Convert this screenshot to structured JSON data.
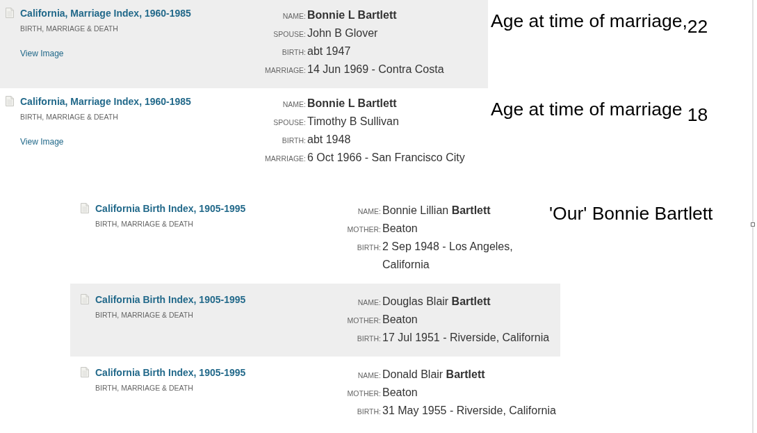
{
  "sections": [
    {
      "kind": "marriage",
      "records": [
        {
          "highlighted": true,
          "title": "California, Marriage Index, 1960-1985",
          "category": "BIRTH, MARRIAGE & DEATH",
          "link": "View Image",
          "fields": [
            {
              "kind": "heading",
              "label": "NAME:",
              "value": "Bonnie L Bartlett"
            },
            {
              "kind": "detail",
              "label": "SPOUSE:",
              "value": "John B Glover"
            },
            {
              "kind": "detail",
              "label": "BIRTH:",
              "value": "abt 1947"
            },
            {
              "kind": "detail",
              "label": "MARRIAGE:",
              "value": "14 Jun 1969 - Contra Costa"
            }
          ],
          "annotation": "Age at time of marriage,$_{22}$"
        },
        {
          "highlighted": false,
          "title": "California, Marriage Index, 1960-1985",
          "category": "BIRTH, MARRIAGE & DEATH",
          "link": "View Image",
          "fields": [
            {
              "kind": "heading",
              "label": "NAME:",
              "value": "Bonnie L Bartlett"
            },
            {
              "kind": "detail",
              "label": "SPOUSE:",
              "value": "Timothy B Sullivan"
            },
            {
              "kind": "detail",
              "label": "BIRTH:",
              "value": "abt 1948"
            },
            {
              "kind": "detail",
              "label": "MARRIAGE:",
              "value": "6 Oct 1966 - San Francisco City"
            }
          ],
          "annotation": "Age at time of marriage $_{18}$"
        }
      ]
    },
    {
      "kind": "birth",
      "records": [
        {
          "highlighted": false,
          "title": "California Birth Index, 1905-1995",
          "category": "BIRTH, MARRIAGE & DEATH",
          "fields": [
            {
              "kind": "detail",
              "label": "NAME:",
              "value": "Bonnie Lillian **Bartlett**"
            },
            {
              "kind": "detail",
              "label": "MOTHER:",
              "value": "Beaton"
            },
            {
              "kind": "detail",
              "label": "BIRTH:",
              "value": "2 Sep 1948 - Los Angeles, California"
            }
          ],
          "annotation": "'Our' Bonnie Bartlett"
        },
        {
          "highlighted": true,
          "title": "California Birth Index, 1905-1995",
          "category": "BIRTH, MARRIAGE & DEATH",
          "fields": [
            {
              "kind": "detail",
              "label": "NAME:",
              "value": "Douglas Blair **Bartlett**"
            },
            {
              "kind": "detail",
              "label": "MOTHER:",
              "value": "Beaton"
            },
            {
              "kind": "detail",
              "label": "BIRTH:",
              "value": "17 Jul 1951 - Riverside, California"
            }
          ]
        },
        {
          "highlighted": false,
          "title": "California Birth Index, 1905-1995",
          "category": "BIRTH, MARRIAGE & DEATH",
          "fields": [
            {
              "kind": "detail",
              "label": "NAME:",
              "value": "Donald Blair **Bartlett**"
            },
            {
              "kind": "detail",
              "label": "MOTHER:",
              "value": "Beaton"
            },
            {
              "kind": "detail",
              "label": "BIRTH:",
              "value": "31 May 1955 - Riverside, California"
            }
          ]
        }
      ]
    }
  ]
}
